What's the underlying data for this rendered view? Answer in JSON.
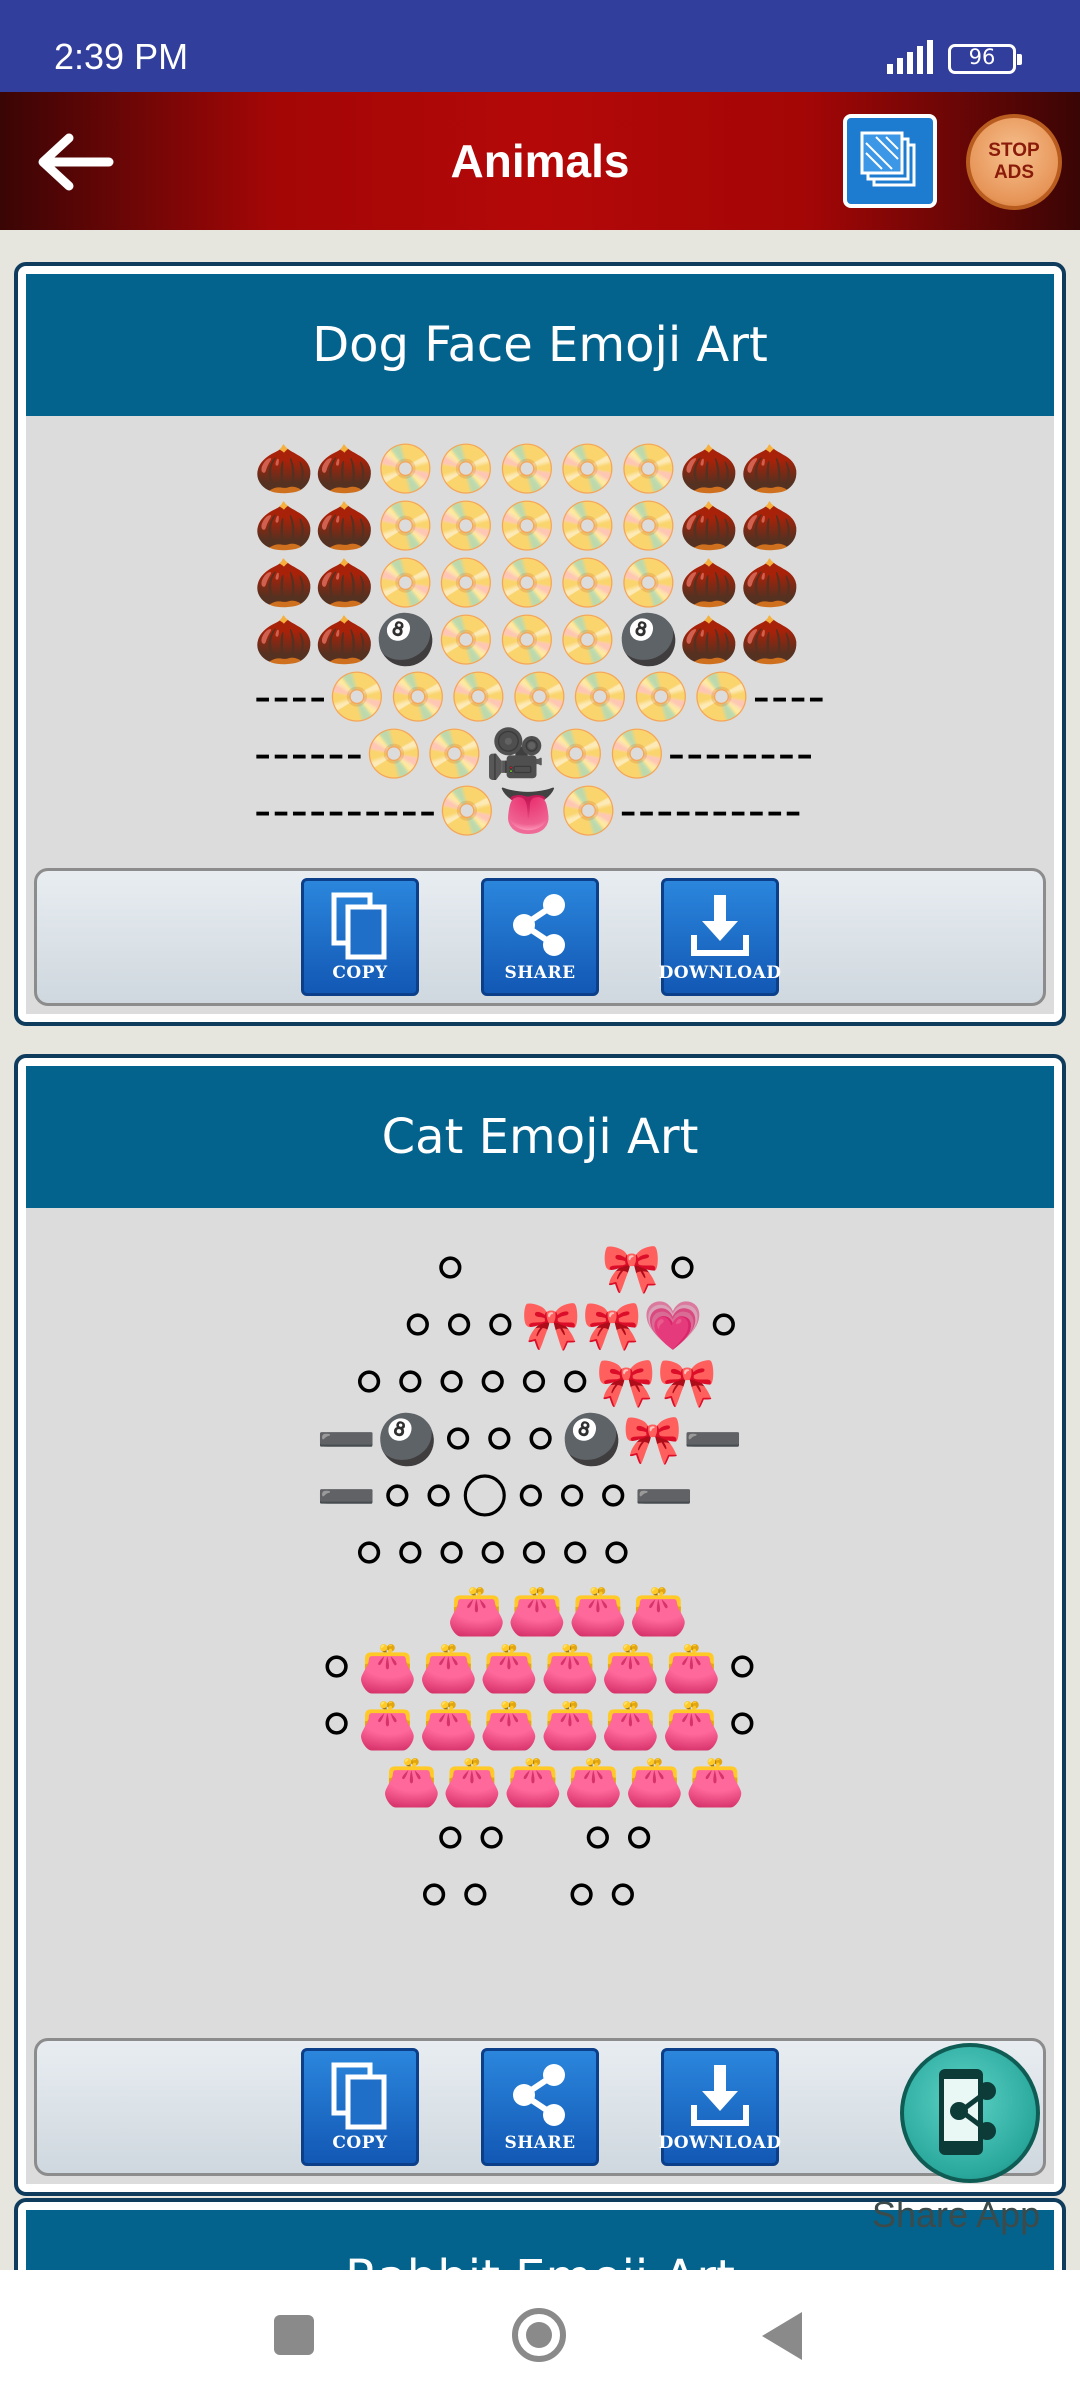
{
  "status_bar": {
    "time": "2:39 PM",
    "battery": "96"
  },
  "toolbar": {
    "title": "Animals",
    "back_icon": "arrow-left-icon",
    "gallery_icon": "gallery-icon",
    "stop_ads_line1": "STOP",
    "stop_ads_line2": "ADS"
  },
  "cards": [
    {
      "title": "Dog Face Emoji Art",
      "art": "🌰🌰📀📀📀📀📀🌰🌰\n🌰🌰📀📀📀📀📀🌰🌰\n🌰🌰📀📀📀📀📀🌰🌰\n🌰🌰🎱📀📀📀🎱🌰🌰\n----📀📀📀📀📀📀📀----\n------📀📀🎥📀📀--------\n----------📀👅📀----------",
      "copy_label": "COPY",
      "share_label": "SHARE",
      "download_label": "DOWNLOAD"
    },
    {
      "title": "Cat Emoji Art",
      "art": "       ⚪        🎀⚪\n     ⚪⚪⚪🎀🎀💗⚪\n  ⚪⚪⚪⚪⚪⚪🎀🎀\n➖🎱⚪⚪⚪🎱🎀➖\n➖⚪⚪🌕⚪⚪⚪➖\n  ⚪⚪⚪⚪⚪⚪⚪\n        👛👛👛👛\n⚪👛👛👛👛👛👛⚪\n⚪👛👛👛👛👛👛⚪\n    👛👛👛👛👛👛\n       ⚪⚪    ⚪⚪\n      ⚪⚪    ⚪⚪",
      "copy_label": "COPY",
      "share_label": "SHARE",
      "download_label": "DOWNLOAD"
    },
    {
      "title": "Rabbit Emoji Art"
    }
  ],
  "fab": {
    "label": "Share App",
    "icon": "share-phone-icon"
  },
  "nav": {
    "recents_icon": "square-icon",
    "home_icon": "circle-icon",
    "back_icon": "triangle-back-icon"
  }
}
